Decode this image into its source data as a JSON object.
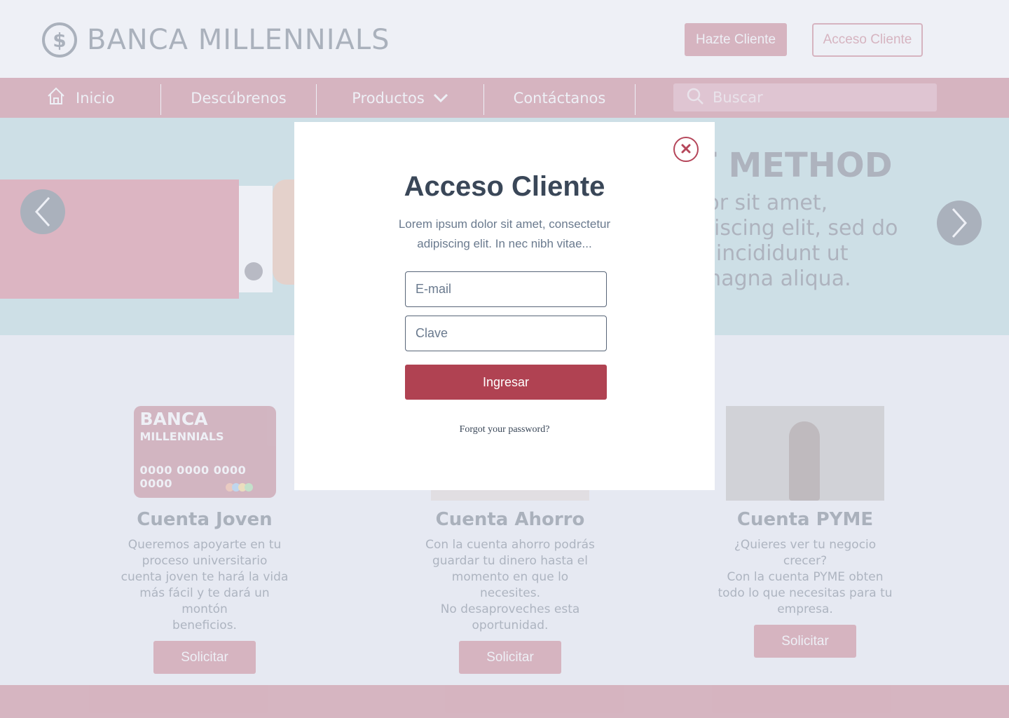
{
  "header": {
    "logo_symbol": "$",
    "logo_text": "BANCA MILLENNIALS",
    "btn_register": "Hazte Cliente",
    "btn_login": "Acceso Cliente"
  },
  "nav": {
    "items": [
      "Inicio",
      "Descúbrenos",
      "Productos",
      "Contáctanos"
    ],
    "search_placeholder": "Buscar"
  },
  "slider": {
    "title": "T METHOD",
    "body": "lor sit amet,\npiscing elit, sed do\nr incididunt ut\nmagna aliqua."
  },
  "cards": [
    {
      "title": "Cuenta Joven",
      "desc": "Queremos apoyarte en tu\nproceso universitario\ncuenta joven te hará la vida\nmás fácil y te dará un montón\nbeneficios.",
      "button": "Solicitar",
      "card_brand": "BANCA",
      "card_brand2": "MILLENNIALS",
      "card_number": "0000 0000 0000 0000"
    },
    {
      "title": "Cuenta Ahorro",
      "desc": "Con la cuenta ahorro podrás\nguardar tu dinero hasta el\nmomento en que lo necesites.\nNo desaproveches esta\noportunidad.",
      "button": "Solicitar"
    },
    {
      "title": "Cuenta PYME",
      "desc": "¿Quieres ver tu negocio\ncrecer?\nCon la cuenta PYME obten\ntodo lo que necesitas para tu\nempresa.",
      "button": "Solicitar"
    }
  ],
  "modal": {
    "title": "Acceso Cliente",
    "subtitle": "Lorem ipsum dolor sit amet, consectetur\nadipiscing elit. In nec nibh vitae...",
    "email_placeholder": "E-mail",
    "password_placeholder": "Clave",
    "submit": "Ingresar",
    "forgot": "Forgot your password?"
  },
  "colors": {
    "brand": "#b5465a",
    "submit": "#b04252",
    "text_dark": "#3a4758",
    "page_bg": "#e6e9f2"
  },
  "icons": [
    "dollar-coin-icon",
    "home-icon",
    "chevron-down-icon",
    "search-icon",
    "arrow-left-icon",
    "arrow-right-icon",
    "close-icon"
  ]
}
